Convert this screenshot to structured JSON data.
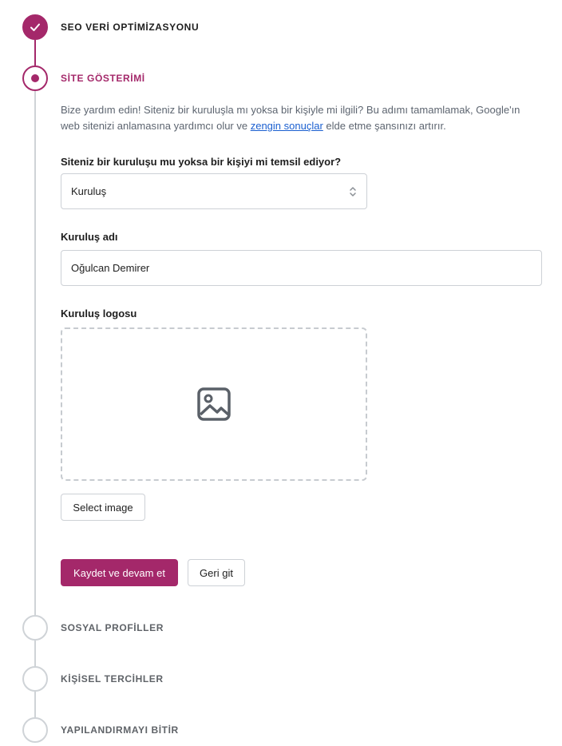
{
  "steps": [
    {
      "title": "SEO VERİ OPTİMİZASYONU",
      "state": "done"
    },
    {
      "title": "SİTE GÖSTERİMİ",
      "state": "active"
    },
    {
      "title": "SOSYAL PROFİLLER",
      "state": "todo"
    },
    {
      "title": "KİŞİSEL TERCİHLER",
      "state": "todo"
    },
    {
      "title": "YAPILANDIRMAYI BİTİR",
      "state": "todo"
    }
  ],
  "site_representation": {
    "description_part1": "Bize yardım edin! Siteniz bir kuruluşla mı yoksa bir kişiyle mi ilgili? Bu adımı tamamlamak, Google'ın web sitenizi anlamasına yardımcı olur ve ",
    "description_link": "zengin sonuçlar",
    "description_part2": " elde etme şansınızı artırır.",
    "type_question": "Siteniz bir kuruluşu mu yoksa bir kişiyi mi temsil ediyor?",
    "type_selected": "Kuruluş",
    "org_name_label": "Kuruluş adı",
    "org_name_value": "Oğulcan Demirer",
    "org_logo_label": "Kuruluş logosu",
    "select_image_label": "Select image",
    "save_continue_label": "Kaydet ve devam et",
    "back_label": "Geri git"
  },
  "colors": {
    "accent": "#a4286a",
    "link": "#1a5fd0",
    "inactive": "#cfd3d7"
  },
  "icons": {
    "done": "checkmark-icon",
    "logo_placeholder": "image-icon",
    "select": "chevron-up-down-icon"
  }
}
